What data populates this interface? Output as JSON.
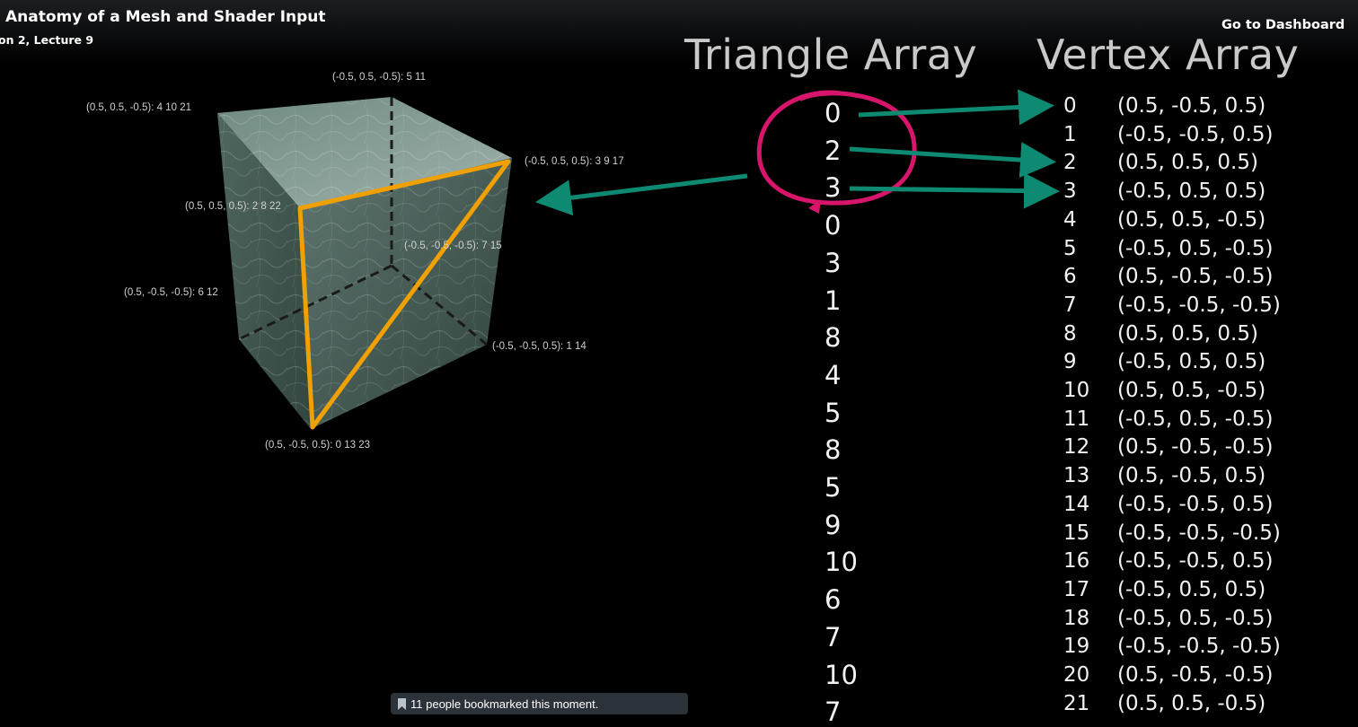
{
  "header": {
    "title": "Anatomy of a Mesh and Shader Input",
    "subtitle": "on 2, Lecture 9",
    "dashboard_link": "Go to Dashboard"
  },
  "slide": {
    "triangle_heading": "Triangle Array",
    "vertex_heading": "Vertex Array",
    "triangle_array": [
      "0",
      "2",
      "3",
      "0",
      "3",
      "1",
      "8",
      "4",
      "5",
      "8",
      "5",
      "9",
      "10",
      "6",
      "7",
      "10",
      "7"
    ],
    "vertex_array": [
      {
        "index": "0",
        "coord": "(0.5, -0.5, 0.5)"
      },
      {
        "index": "1",
        "coord": "(-0.5, -0.5, 0.5)"
      },
      {
        "index": "2",
        "coord": "(0.5, 0.5, 0.5)"
      },
      {
        "index": "3",
        "coord": "(-0.5, 0.5, 0.5)"
      },
      {
        "index": "4",
        "coord": "(0.5, 0.5, -0.5)"
      },
      {
        "index": "5",
        "coord": "(-0.5, 0.5, -0.5)"
      },
      {
        "index": "6",
        "coord": "(0.5, -0.5, -0.5)"
      },
      {
        "index": "7",
        "coord": "(-0.5, -0.5, -0.5)"
      },
      {
        "index": "8",
        "coord": "(0.5, 0.5, 0.5)"
      },
      {
        "index": "9",
        "coord": "(-0.5, 0.5, 0.5)"
      },
      {
        "index": "10",
        "coord": "(0.5, 0.5, -0.5)"
      },
      {
        "index": "11",
        "coord": "(-0.5, 0.5, -0.5)"
      },
      {
        "index": "12",
        "coord": "(0.5, -0.5, -0.5)"
      },
      {
        "index": "13",
        "coord": "(0.5, -0.5, 0.5)"
      },
      {
        "index": "14",
        "coord": "(-0.5, -0.5, 0.5)"
      },
      {
        "index": "15",
        "coord": "(-0.5, -0.5, -0.5)"
      },
      {
        "index": "16",
        "coord": "(-0.5, -0.5, 0.5)"
      },
      {
        "index": "17",
        "coord": "(-0.5, 0.5, 0.5)"
      },
      {
        "index": "18",
        "coord": "(-0.5, 0.5, -0.5)"
      },
      {
        "index": "19",
        "coord": "(-0.5, -0.5, -0.5)"
      },
      {
        "index": "20",
        "coord": "(0.5, -0.5, -0.5)"
      },
      {
        "index": "21",
        "coord": "(0.5, 0.5, -0.5)"
      }
    ],
    "cube_labels": {
      "top_back": "(-0.5, 0.5, -0.5): 5 11",
      "top_left": "(0.5, 0.5, -0.5): 4 10 21",
      "top_right": "(-0.5, 0.5, 0.5): 3 9 17",
      "front_top_left": "(0.5, 0.5, 0.5): 2 8 22",
      "hidden_back": "(-0.5, -0.5, -0.5): 7 15",
      "left_bottom": "(0.5, -0.5, -0.5): 6 12",
      "right_bottom": "(-0.5, -0.5, 0.5): 1 14",
      "front_bottom": "(0.5, -0.5, 0.5): 0 13 23"
    },
    "colors": {
      "triangle_outline": "#f0a000",
      "arrow": "#0e8a72",
      "circle_annotation": "#d6156b",
      "heading": "#c9c9c9"
    }
  },
  "bookmark": {
    "text": "11 people bookmarked this moment."
  }
}
